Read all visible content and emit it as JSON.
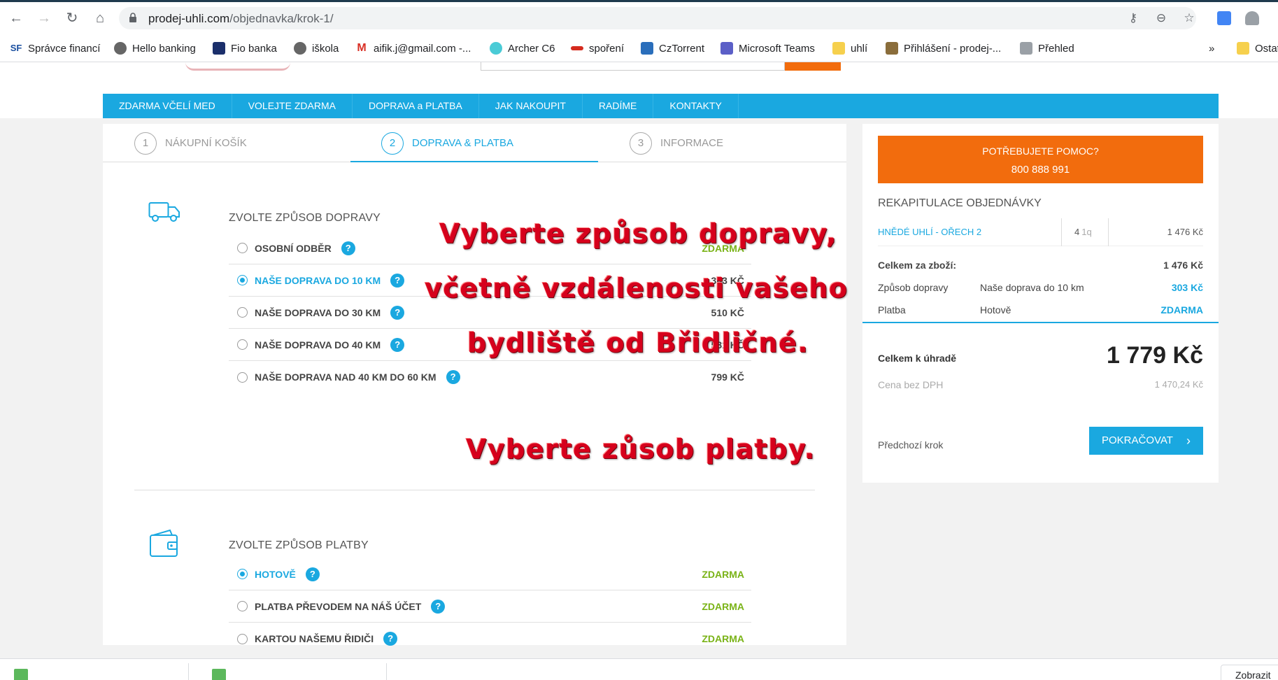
{
  "browser": {
    "url_host": "prodej-uhli.com",
    "url_path": "/objednavka/krok-1/",
    "bookmarks": [
      {
        "label": "Správce financí",
        "icon": "sf-icon"
      },
      {
        "label": "Hello banking",
        "icon": "globe-icon"
      },
      {
        "label": "Fio banka",
        "icon": "fio-icon"
      },
      {
        "label": "iškola",
        "icon": "globe-icon"
      },
      {
        "label": "aifik.j@gmail.com -...",
        "icon": "gmail-icon"
      },
      {
        "label": "Archer C6",
        "icon": "tplink-icon"
      },
      {
        "label": "spoření",
        "icon": "bank-icon"
      },
      {
        "label": "CzTorrent",
        "icon": "torrent-icon"
      },
      {
        "label": "Microsoft Teams",
        "icon": "teams-icon"
      },
      {
        "label": "uhlí",
        "icon": "folder-icon"
      },
      {
        "label": "Přihlášení - prodej-...",
        "icon": "site-icon"
      },
      {
        "label": "Přehled",
        "icon": "site-icon"
      }
    ],
    "bookmarks_more": "»",
    "bookmarks_other": "Ostat",
    "download_show_all": "Zobrazit"
  },
  "nav": {
    "items": [
      "ZDARMA VČELÍ MED",
      "VOLEJTE ZDARMA",
      "DOPRAVA a PLATBA",
      "JAK NAKOUPIT",
      "RADÍME",
      "KONTAKTY"
    ]
  },
  "steps": [
    {
      "num": "1",
      "label": "NÁKUPNÍ KOŠÍK"
    },
    {
      "num": "2",
      "label": "DOPRAVA & PLATBA"
    },
    {
      "num": "3",
      "label": "INFORMACE"
    }
  ],
  "shipping": {
    "title": "ZVOLTE ZPŮSOB DOPRAVY",
    "options": [
      {
        "label": "OSOBNÍ ODBĚR",
        "price": "ZDARMA"
      },
      {
        "label": "NAŠE DOPRAVA DO 10 KM",
        "price": "303 KČ"
      },
      {
        "label": "NAŠE DOPRAVA DO 30 KM",
        "price": "510 KČ"
      },
      {
        "label": "NAŠE DOPRAVA DO 40 KM",
        "price": "581 KČ"
      },
      {
        "label": "NAŠE DOPRAVA NAD 40 KM DO 60 KM",
        "price": "799 KČ"
      }
    ]
  },
  "payment": {
    "title": "ZVOLTE ZPŮSOB PLATBY",
    "options": [
      {
        "label": "HOTOVĚ",
        "price": "ZDARMA"
      },
      {
        "label": "PLATBA PŘEVODEM NA NÁŠ ÚČET",
        "price": "ZDARMA"
      },
      {
        "label": "KARTOU NAŠEMU ŘIDIČI",
        "price": "ZDARMA"
      }
    ]
  },
  "help_glyph": "?",
  "summary": {
    "help_line1": "POTŘEBUJETE POMOC?",
    "help_line2": "800 888 991",
    "title": "REKAPITULACE OBJEDNÁVKY",
    "item": {
      "name": "HNĚDÉ UHLÍ - OŘECH 2",
      "qty": "4",
      "unit": "1q",
      "price": "1 476 Kč"
    },
    "goods_label": "Celkem za zboží:",
    "goods_value": "1 476 Kč",
    "shipping_label": "Způsob dopravy",
    "shipping_method": "Naše doprava do 10 km",
    "shipping_value": "303 Kč",
    "payment_label": "Platba",
    "payment_method": "Hotově",
    "payment_value": "ZDARMA",
    "total_label": "Celkem k úhradě",
    "total_value": "1 779 Kč",
    "nodph_label": "Cena bez DPH",
    "nodph_value": "1 470,24 Kč",
    "prev_label": "Předchozí krok",
    "continue_label": "POKRAČOVAT",
    "continue_chevron": "›"
  },
  "annotations": {
    "line1": "Vyberte způsob dopravy,",
    "line2": "včetně vzdálenosti vašeho",
    "line3": "bydliště od Břidličné.",
    "line4": "Vyberte zůsob platby."
  },
  "colors": {
    "accent": "#1aa8e0",
    "orange": "#f26c0d",
    "free_green": "#7ab317",
    "annotation_red": "#d6001c"
  }
}
